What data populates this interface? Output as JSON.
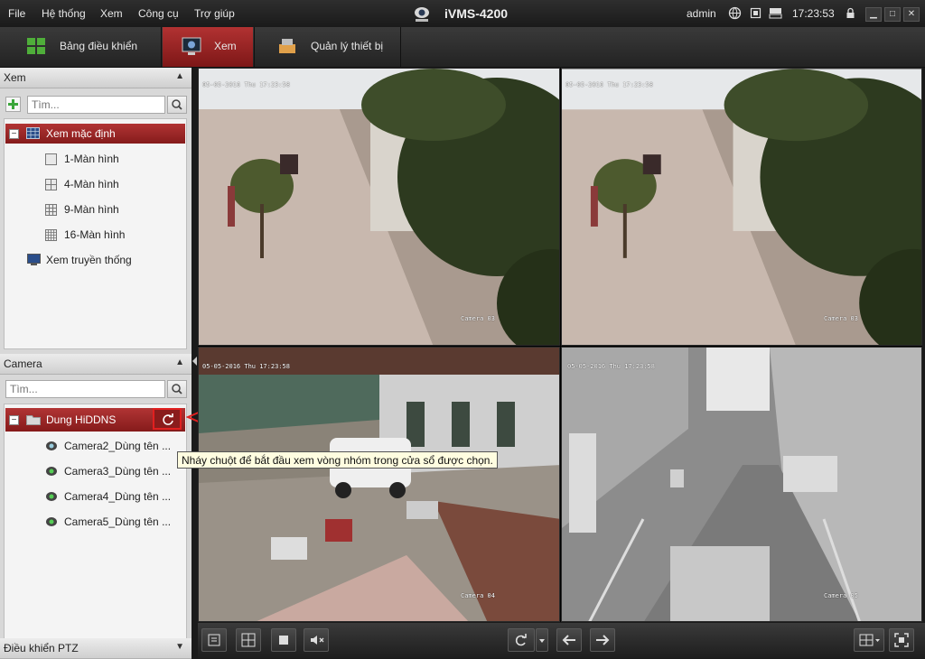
{
  "menu": {
    "items": [
      {
        "label": "File"
      },
      {
        "label": "Hệ thống"
      },
      {
        "label": "Xem"
      },
      {
        "label": "Công cụ"
      },
      {
        "label": "Trợ giúp"
      }
    ],
    "app_title": "iVMS-4200",
    "user": "admin",
    "clock": "17:23:53",
    "window_buttons": {
      "minimize": "▁",
      "maximize": "□",
      "close": "✕"
    }
  },
  "tabs": [
    {
      "label": "Bảng điều khiển"
    },
    {
      "label": "Xem"
    },
    {
      "label": "Quản lý thiết bị"
    }
  ],
  "view_section": {
    "title": "Xem",
    "search_placeholder": "Tìm...",
    "tree": {
      "group_label": "Xem mặc định",
      "layouts": [
        {
          "label": "1-Màn hình"
        },
        {
          "label": "4-Màn hình"
        },
        {
          "label": "9-Màn hình"
        },
        {
          "label": "16-Màn hình"
        }
      ],
      "traditional_label": "Xem truyền thống"
    }
  },
  "camera_section": {
    "title": "Camera",
    "search_placeholder": "Tìm...",
    "group_label": "Dung HiDDNS",
    "cameras": [
      {
        "label": "Camera2_Dùng tên ..."
      },
      {
        "label": "Camera3_Dùng tên ..."
      },
      {
        "label": "Camera4_Dùng tên ..."
      },
      {
        "label": "Camera5_Dùng tên ..."
      }
    ]
  },
  "ptz_section": {
    "title": "Điều khiển PTZ"
  },
  "tooltip": "Nháy chuột để bắt đầu xem vòng nhóm trong cửa sổ được chọn.",
  "tiles": [
    {
      "timestamp": "05-05-2016 Thu 17:23:58",
      "camera": "Camera 03"
    },
    {
      "timestamp": "05-05-2016 Thu 17:23:58",
      "camera": "Camera 03"
    },
    {
      "timestamp": "05-05-2016 Thu 17:23:58",
      "camera": "Camera 04"
    },
    {
      "timestamp": "05-05-2016 Thu 17:23:58",
      "camera": "Camera 05"
    }
  ],
  "colors": {
    "accent_red": "#9c2323",
    "highlight_box": "#e02020"
  }
}
